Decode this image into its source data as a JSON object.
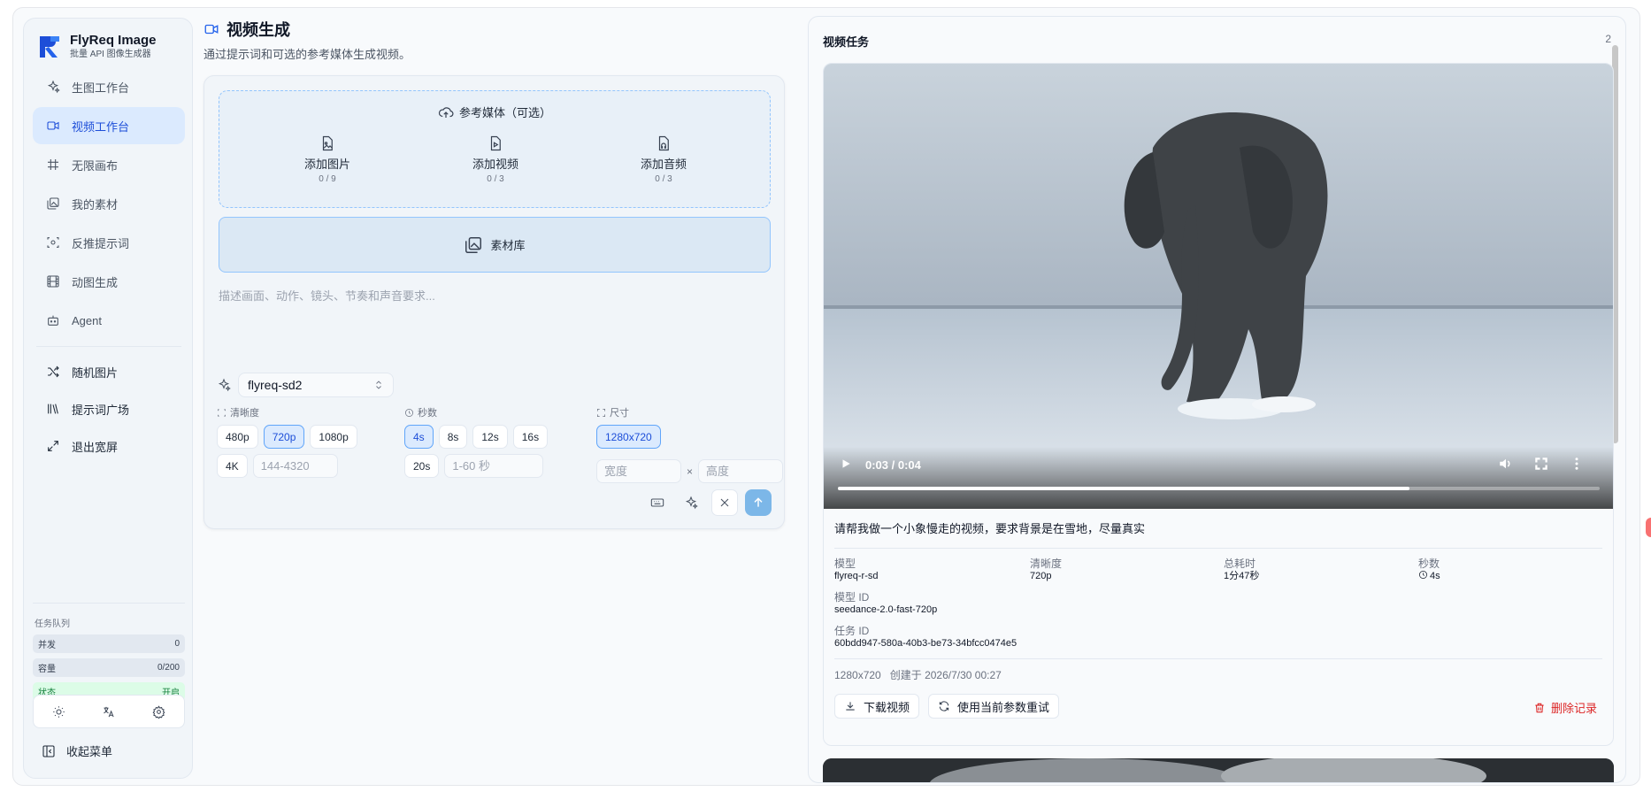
{
  "brand": {
    "title": "FlyReq Image",
    "subtitle": "批量 API 图像生成器"
  },
  "nav": {
    "items": [
      {
        "label": "生图工作台",
        "icon": "sparkles-icon"
      },
      {
        "label": "视频工作台",
        "icon": "video-icon",
        "active": true
      },
      {
        "label": "无限画布",
        "icon": "hash-icon"
      },
      {
        "label": "我的素材",
        "icon": "images-icon"
      },
      {
        "label": "反推提示词",
        "icon": "scan-icon"
      },
      {
        "label": "动图生成",
        "icon": "film-icon"
      },
      {
        "label": "Agent",
        "icon": "bot-icon"
      }
    ],
    "extra": [
      {
        "label": "随机图片",
        "icon": "shuffle-icon"
      },
      {
        "label": "提示词广场",
        "icon": "library-icon"
      },
      {
        "label": "退出宽屏",
        "icon": "expand-icon"
      }
    ]
  },
  "queue": {
    "title": "任务队列",
    "rows": [
      {
        "label": "并发",
        "value": "0"
      },
      {
        "label": "容量",
        "value": "0/200"
      },
      {
        "label": "状态",
        "value": "开启"
      }
    ]
  },
  "sidebar_footer": {
    "collapse_label": "收起菜单"
  },
  "page": {
    "title": "视频生成",
    "subtitle": "通过提示词和可选的参考媒体生成视频。"
  },
  "reference": {
    "title": "参考媒体（可选）",
    "slots": [
      {
        "label": "添加图片",
        "count": "0 / 9"
      },
      {
        "label": "添加视频",
        "count": "0 / 3"
      },
      {
        "label": "添加音频",
        "count": "0 / 3"
      }
    ],
    "library_label": "素材库"
  },
  "prompt": {
    "placeholder": "描述画面、动作、镜头、节奏和声音要求..."
  },
  "model": {
    "selected": "flyreq-sd2"
  },
  "resolution": {
    "label": "清晰度",
    "options": [
      "480p",
      "720p",
      "1080p",
      "4K"
    ],
    "selected": "720p",
    "custom_placeholder": "144-4320"
  },
  "seconds": {
    "label": "秒数",
    "options": [
      "4s",
      "8s",
      "12s",
      "16s",
      "20s"
    ],
    "selected": "4s",
    "custom_placeholder": "1-60 秒"
  },
  "size": {
    "label": "尺寸",
    "options": [
      "1280x720"
    ],
    "selected": "1280x720",
    "width_placeholder": "宽度",
    "height_placeholder": "高度",
    "times": "×"
  },
  "tasks": {
    "title": "视频任务",
    "count": "2",
    "items": [
      {
        "video": {
          "time": "0:03 / 0:04",
          "progress": 0.75
        },
        "prompt": "请帮我做一个小象慢走的视频，要求背景是在雪地，尽量真实",
        "meta": {
          "model_key": "模型",
          "model": "flyreq-r-sd",
          "res_key": "清晰度",
          "res": "720p",
          "elapsed_key": "总耗时",
          "elapsed": "1分47秒",
          "sec_key": "秒数",
          "sec": "4s",
          "model_id_key": "模型 ID",
          "model_id": "seedance-2.0-fast-720p",
          "task_id_key": "任务 ID",
          "task_id": "60bdd947-580a-40b3-be73-34bfcc0474e5"
        },
        "size": "1280x720",
        "created": "创建于 2026/7/30 00:27",
        "download_label": "下载视频",
        "retry_label": "使用当前参数重试",
        "delete_label": "删除记录"
      }
    ]
  },
  "colors": {
    "accent": "#2563eb",
    "active_bg": "#dbeafe",
    "danger": "#dc2626",
    "send": "#7cb7e8"
  }
}
